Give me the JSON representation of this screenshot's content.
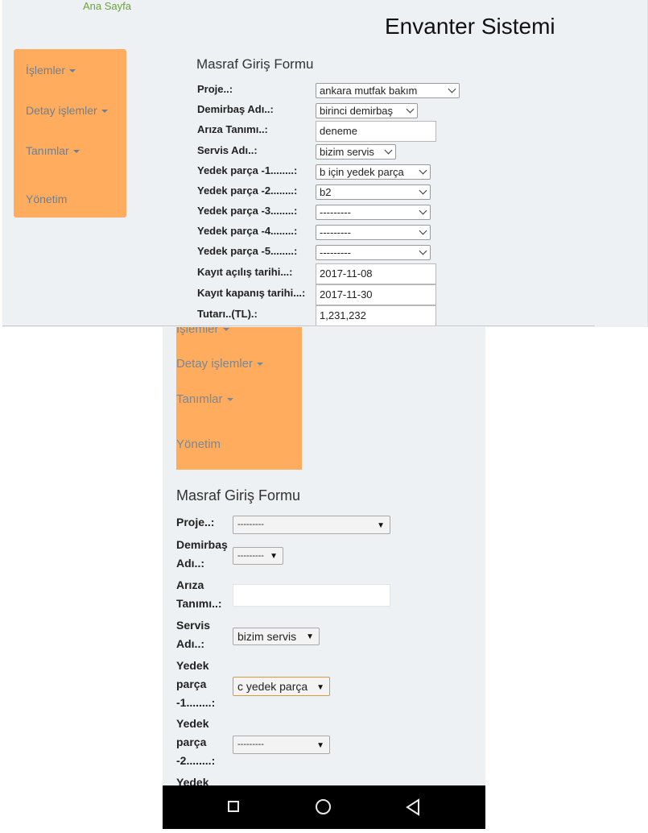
{
  "desktop": {
    "home_link": "Ana Sayfa",
    "app_title": "Envanter Sistemi",
    "sidebar": [
      {
        "label": "İşlemler",
        "caret": true
      },
      {
        "label": "Detay işlemler",
        "caret": true
      },
      {
        "label": "Tanımlar",
        "caret": true
      },
      {
        "label": "Yönetim",
        "caret": false
      }
    ],
    "form": {
      "title": "Masraf Giriş Formu",
      "fields": [
        {
          "label": "Proje..:",
          "type": "select",
          "value": "ankara mutfak bakım"
        },
        {
          "label": "Demirbaş Adı..:",
          "type": "select",
          "value": "birinci demirbaş"
        },
        {
          "label": "Arıza Tanımı..:",
          "type": "input",
          "value": "deneme"
        },
        {
          "label": "Servis Adı..:",
          "type": "select",
          "value": "bizim servis"
        },
        {
          "label": "Yedek parça -1........:",
          "type": "select",
          "value": "b için yedek parça"
        },
        {
          "label": "Yedek parça -2........:",
          "type": "select",
          "value": "b2"
        },
        {
          "label": "Yedek parça -3........:",
          "type": "select",
          "value": "---------"
        },
        {
          "label": "Yedek parça -4........:",
          "type": "select",
          "value": "---------"
        },
        {
          "label": "Yedek parça -5........:",
          "type": "select",
          "value": "---------"
        },
        {
          "label": "Kayıt açılış tarihi...:",
          "type": "input",
          "value": "2017-11-08"
        },
        {
          "label": "Kayıt kapanış tarihi...:",
          "type": "input",
          "value": "2017-11-30"
        },
        {
          "label": "Tutarı..(TL).:",
          "type": "input",
          "value": "1,231,232"
        }
      ]
    }
  },
  "mobile": {
    "sidebar": [
      {
        "label": "İşlemler",
        "caret": true
      },
      {
        "label": "Detay işlemler",
        "caret": true
      },
      {
        "label": "Tanımlar",
        "caret": true
      },
      {
        "label": "Yönetim",
        "caret": false
      }
    ],
    "form": {
      "title": "Masraf Giriş Formu",
      "fields": [
        {
          "label": [
            "Proje..:"
          ],
          "type": "select",
          "value": "---------"
        },
        {
          "label": [
            "Demirbaş",
            "Adı..:"
          ],
          "type": "select",
          "value": "---------"
        },
        {
          "label": [
            "Arıza",
            "Tanımı..:"
          ],
          "type": "input",
          "value": ""
        },
        {
          "label": [
            "Servis",
            "Adı..:"
          ],
          "type": "select",
          "value": "bizim servis"
        },
        {
          "label": [
            "Yedek",
            "parça",
            "-1........:"
          ],
          "type": "select",
          "value": "c yedek parça",
          "focused": true
        },
        {
          "label": [
            "Yedek",
            "parça",
            "-2........:"
          ],
          "type": "select",
          "value": "---------"
        },
        {
          "label": [
            "Yedek"
          ],
          "type": "label-only",
          "value": ""
        }
      ]
    },
    "nav_buttons": [
      "recent-apps-icon",
      "home-icon",
      "back-icon"
    ]
  }
}
